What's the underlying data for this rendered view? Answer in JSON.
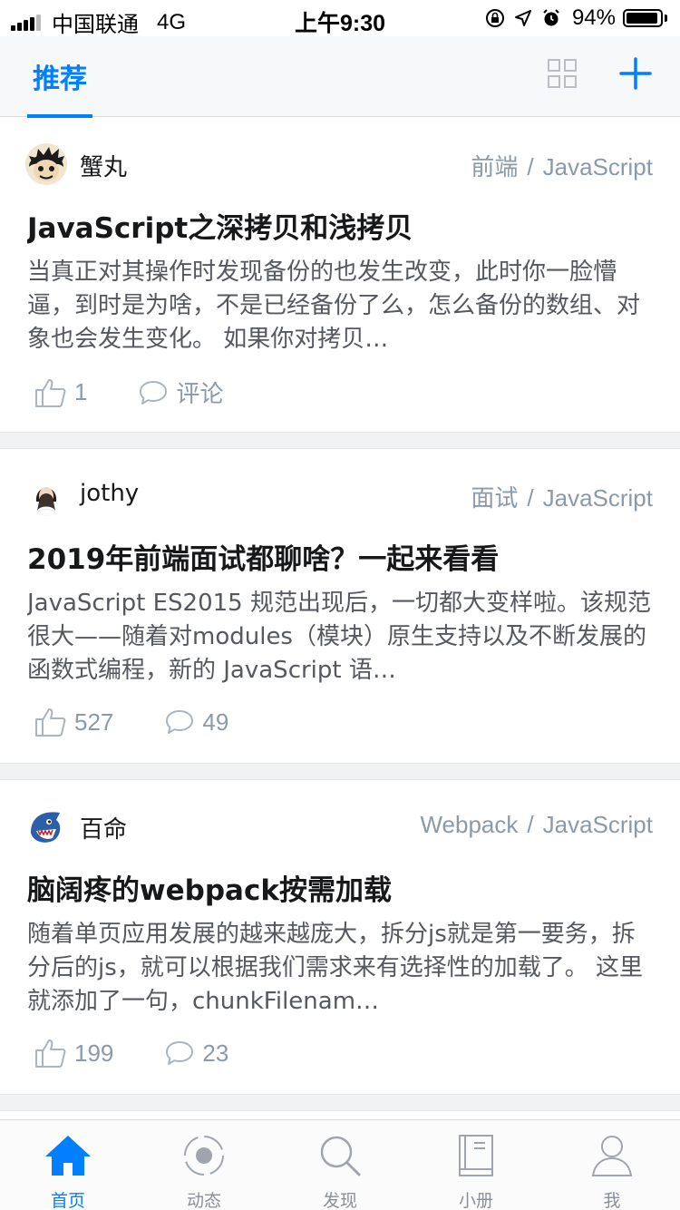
{
  "status_bar": {
    "carrier": "中国联通",
    "network": "4G",
    "time": "上午9:30",
    "battery_text": "94%",
    "battery_level": 0.94
  },
  "topnav": {
    "active_tab": "推荐",
    "icons": [
      "grid-icon",
      "plus-icon"
    ]
  },
  "feed": [
    {
      "author": "蟹丸",
      "tags": [
        "前端",
        "JavaScript"
      ],
      "title": "JavaScript之深拷贝和浅拷贝",
      "excerpt": "当真正对其操作时发现备份的也发生改变，此时你一脸懵逼，到时是为啥，不是已经备份了么，怎么备份的数组、对象也会发生变化。 如果你对拷贝…",
      "likes": "1",
      "comments": "评论"
    },
    {
      "author": "jothy",
      "tags": [
        "面试",
        "JavaScript"
      ],
      "title": "2019年前端面试都聊啥？一起来看看",
      "excerpt": "JavaScript ES2015 规范出现后，一切都大变样啦。该规范很大——随着对modules（模块）原生支持以及不断发展的函数式编程，新的 JavaScript 语…",
      "likes": "527",
      "comments": "49"
    },
    {
      "author": "百命",
      "tags": [
        "Webpack",
        "JavaScript"
      ],
      "title": "脑阔疼的webpack按需加载",
      "excerpt": "随着单页应用发展的越来越庞大，拆分js就是第一要务，拆分后的js，就可以根据我们需求来有选择性的加载了。 这里就添加了一句，chunkFilenam…",
      "likes": "199",
      "comments": "23"
    }
  ],
  "tabbar": [
    {
      "label": "首页",
      "icon": "home-icon",
      "active": true
    },
    {
      "label": "动态",
      "icon": "activity-icon",
      "active": false
    },
    {
      "label": "发现",
      "icon": "search-icon",
      "active": false
    },
    {
      "label": "小册",
      "icon": "book-icon",
      "active": false
    },
    {
      "label": "我",
      "icon": "user-icon",
      "active": false
    }
  ],
  "colors": {
    "accent": "#007fff",
    "meta": "#8a9aa9",
    "text": "#17181a",
    "excerpt": "#55595f"
  }
}
